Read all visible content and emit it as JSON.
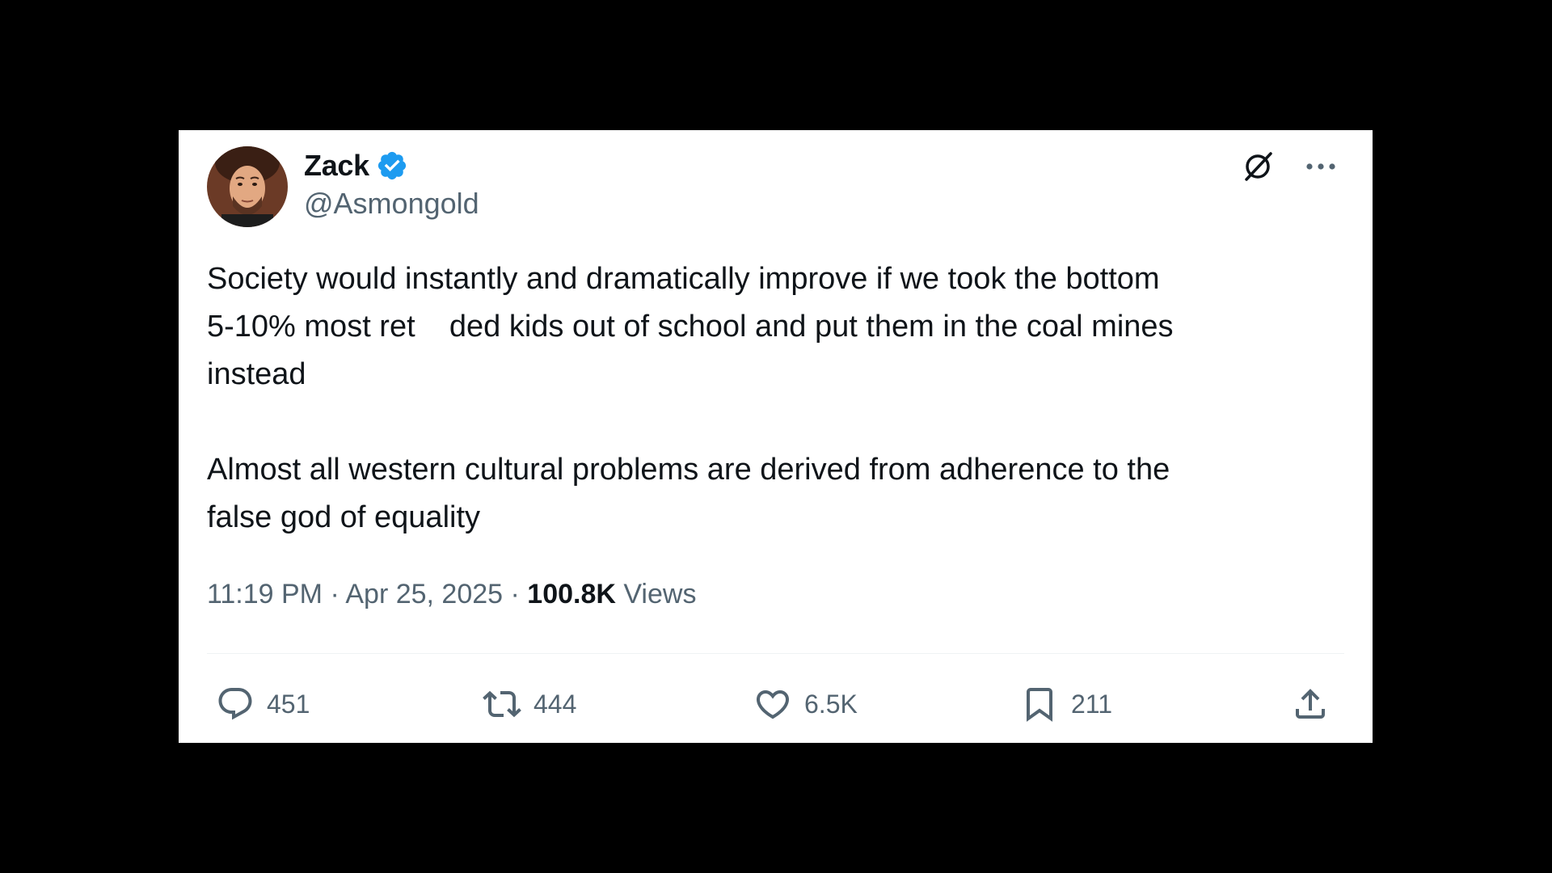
{
  "author": {
    "display_name": "Zack",
    "handle": "@Asmongold",
    "verified": true,
    "verified_color": "#1d9bf0"
  },
  "tweet": {
    "paragraphs": [
      "Society would instantly and dramatically improve if we took the bottom\n5-10% most ret    ded kids out of school and put them in the coal mines\ninstead",
      "Almost all western cultural problems are derived from adherence to the\nfalse god of equality"
    ]
  },
  "meta": {
    "time": "11:19 PM",
    "separator": " · ",
    "date": "Apr 25, 2025",
    "views_count": "100.8K",
    "views_label": " Views"
  },
  "actions": {
    "replies": "451",
    "reposts": "444",
    "likes": "6.5K",
    "bookmarks": "211"
  },
  "icons": {
    "top": [
      "grok-icon",
      "more-icon"
    ],
    "actions": [
      "reply-icon",
      "repost-icon",
      "like-icon",
      "bookmark-icon",
      "share-icon"
    ]
  },
  "colors": {
    "text_primary": "#0f1419",
    "text_secondary": "#536471",
    "background": "#ffffff",
    "frame": "#000000"
  }
}
